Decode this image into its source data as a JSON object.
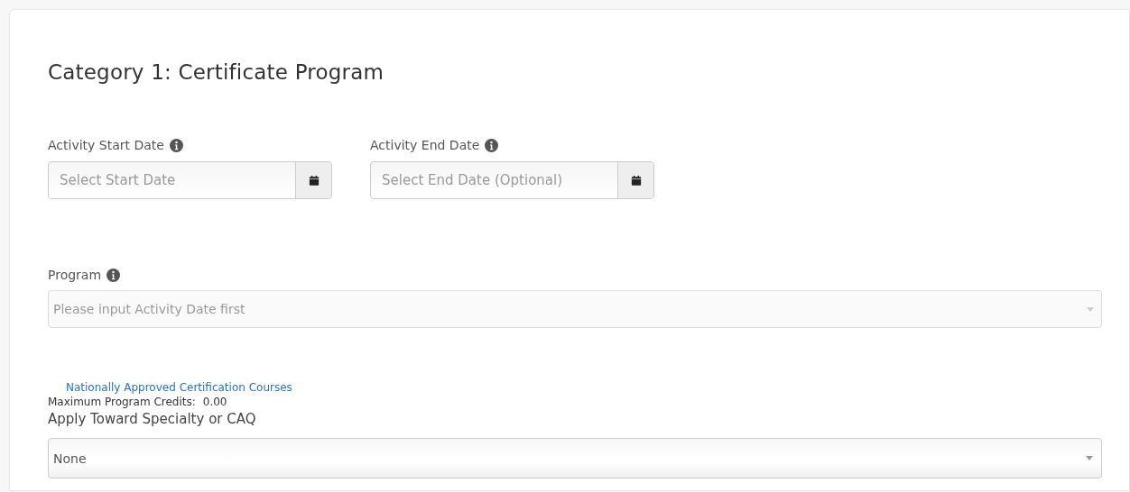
{
  "heading": "Category 1: Certificate Program",
  "date_fields": [
    {
      "label": "Activity Start Date",
      "placeholder": "Select Start Date"
    },
    {
      "label": "Activity End Date",
      "placeholder": "Select End Date (Optional)"
    }
  ],
  "program": {
    "label": "Program",
    "value": "Please input Activity Date first",
    "disabled": true
  },
  "link": "Nationally Approved Certification Courses",
  "max_credits": {
    "label": "Maximum Program Credits:",
    "value": "0.00"
  },
  "specialty": {
    "label": "Apply Toward Specialty or CAQ",
    "value": "None",
    "disabled": false
  }
}
